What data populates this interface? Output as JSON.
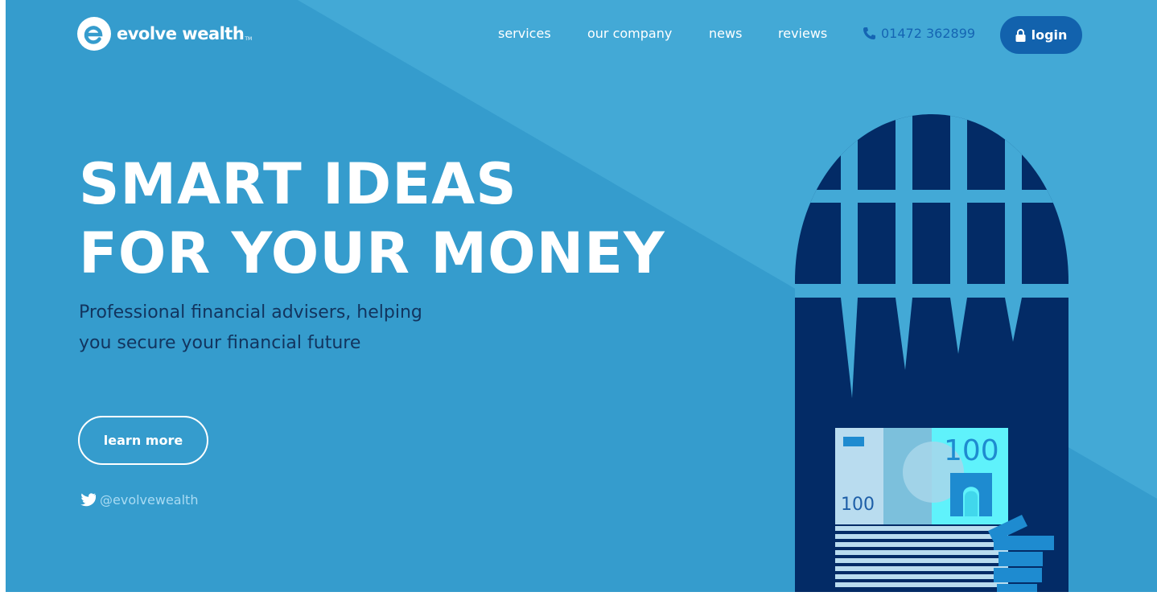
{
  "brand": {
    "name": "evolve wealth",
    "tm": "TM"
  },
  "nav": {
    "links": [
      {
        "label": "services"
      },
      {
        "label": "our company"
      },
      {
        "label": "news"
      },
      {
        "label": "reviews"
      }
    ],
    "phone": "01472 362899",
    "login_label": "login"
  },
  "hero": {
    "title_line1": "SMART IDEAS",
    "title_line2": "FOR YOUR MONEY",
    "subtitle": "Professional financial advisers, helping you secure your financial future",
    "cta_label": "learn more",
    "twitter_handle": "@evolvewealth"
  },
  "illustration": {
    "note_value": "100",
    "note_value_small": "100"
  },
  "colors": {
    "background": "#3aa0d1",
    "background_light": "#43a9d6",
    "navy": "#032b66",
    "login_button": "#1262ad",
    "phone_text": "#1565b3",
    "subtitle_text": "#12345e"
  },
  "icons": {
    "logo": "evolve-logo-icon",
    "phone": "phone-icon",
    "login": "lock-icon",
    "twitter": "twitter-icon"
  }
}
